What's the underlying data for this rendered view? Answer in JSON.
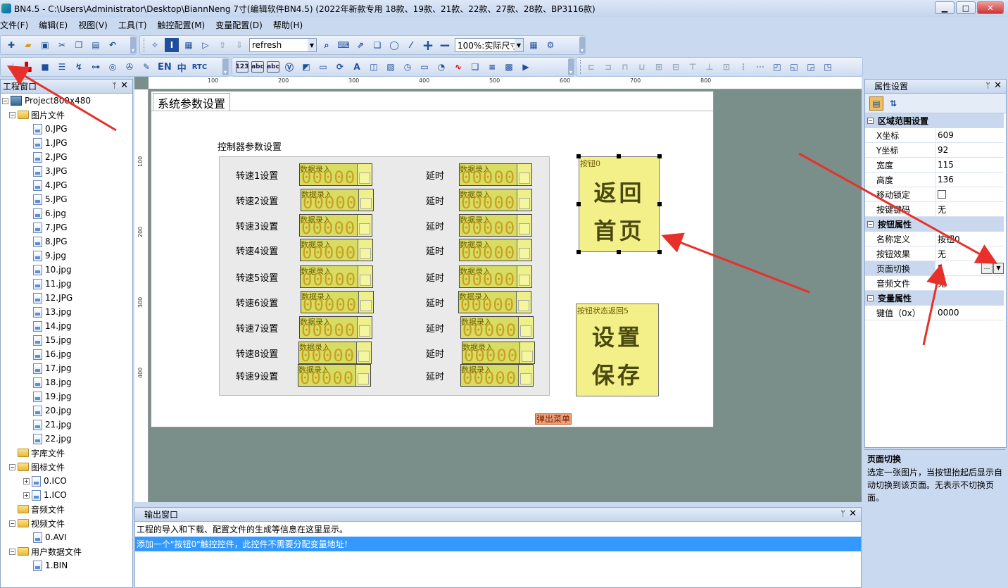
{
  "window": {
    "title": "BN4.5 - C:\\Users\\Administrator\\Desktop\\BiannNeng 7寸(编辑软件BN4.5) (2022年新款专用 18款、19款、21款、22款、27款、28款、BP3116款)",
    "minimize": "▁",
    "maximize": "□",
    "close": "✕"
  },
  "menu": [
    "文件(F)",
    "编辑(E)",
    "视图(V)",
    "工具(T)",
    "触控配置(M)",
    "变量配置(D)",
    "帮助(H)"
  ],
  "toolbar": {
    "refresh_value": "refresh",
    "zoom_value": "100%:实际尺寸",
    "text_tools": [
      "EN",
      "中",
      "RTC"
    ],
    "small_labels": [
      "123",
      "abc",
      "abc"
    ]
  },
  "project_panel": {
    "title": "工程窗口",
    "pin": "ᛘ",
    "close": "✕",
    "root": "Project800x480",
    "image_folder": "图片文件",
    "images": [
      "0.JPG",
      "1.JPG",
      "2.JPG",
      "3.JPG",
      "4.JPG",
      "5.JPG",
      "6.jpg",
      "7.JPG",
      "8.JPG",
      "9.jpg",
      "10.jpg",
      "11.jpg",
      "12.JPG",
      "13.jpg",
      "14.jpg",
      "15.jpg",
      "16.jpg",
      "17.jpg",
      "18.jpg",
      "19.jpg",
      "20.jpg",
      "21.jpg",
      "22.jpg"
    ],
    "font_folder": "字库文件",
    "icon_folder": "图标文件",
    "icons": [
      "0.ICO",
      "1.ICO"
    ],
    "audio_folder": "音频文件",
    "video_folder": "视频文件",
    "videos": [
      "0.AVI"
    ],
    "userdata_folder": "用户数据文件",
    "userdata": [
      "1.BIN"
    ]
  },
  "rulers": {
    "h_marks": [
      "100",
      "200",
      "300",
      "400",
      "500",
      "600",
      "700",
      "800"
    ],
    "v_marks": [
      "100",
      "200",
      "300",
      "400"
    ]
  },
  "canvas": {
    "tab_title": "系统参数设置",
    "group_title": "控制器参数设置",
    "speed_labels": [
      "转速1设置",
      "转速2设置",
      "转速3设置",
      "转速4设置",
      "转速5设置",
      "转速6设置",
      "转速7设置",
      "转速8设置",
      "转速9设置"
    ],
    "delay_label": "延时",
    "input_caption": "数据录入",
    "input_value": "00000",
    "button0": {
      "caption": "按钮0",
      "line1": "返回",
      "line2": "首页"
    },
    "button1": {
      "caption": "按钮状态返回5",
      "line1": "设置",
      "line2": "保存"
    },
    "popup_text": "弹出菜单"
  },
  "output_panel": {
    "title": "输出窗口",
    "pin": "ᛘ",
    "close": "✕",
    "line1": "工程的导入和下载、配置文件的生成等信息在这里显示。",
    "line2": "添加一个\"按钮0\"触控控件，此控件不需要分配变量地址！"
  },
  "property_panel": {
    "title": "属性设置",
    "pin": "ᛘ",
    "close": "✕",
    "cat_area": "区域范围设置",
    "x_label": "X坐标",
    "x_value": "609",
    "y_label": "Y坐标",
    "y_value": "92",
    "w_label": "宽度",
    "w_value": "115",
    "h_label": "高度",
    "h_value": "136",
    "lock_label": "移动锁定",
    "key_label": "按键键码",
    "key_value": "无",
    "cat_button": "按钮属性",
    "name_label": "名称定义",
    "name_value": "按钮0",
    "effect_label": "按钮效果",
    "effect_value": "无",
    "page_label": "页面切换",
    "page_value": "5",
    "audio_label": "音频文件",
    "audio_value": "无",
    "cat_var": "变量属性",
    "keyval_label": "键值（0x）",
    "keyval_value": "0000",
    "desc_title": "页面切换",
    "desc_text": "选定一张图片，当按钮抬起后显示自动切换到该页面。无表示不切换页面。"
  }
}
